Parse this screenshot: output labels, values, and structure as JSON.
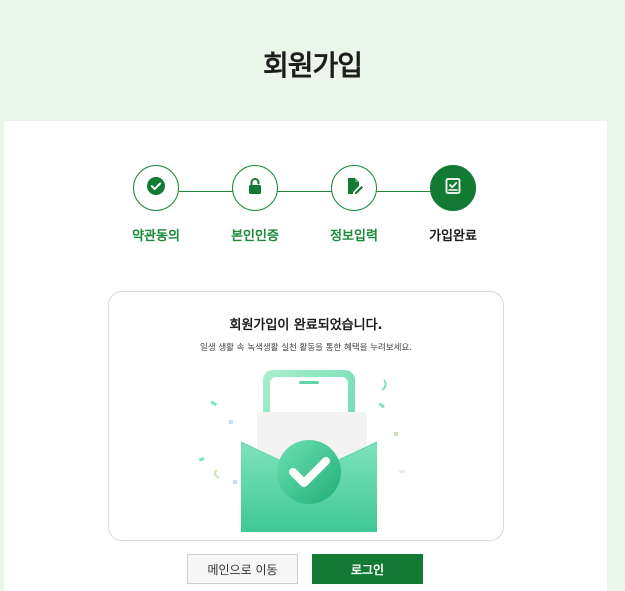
{
  "header": {
    "title": "회원가입"
  },
  "steps": [
    {
      "label": "약관동의",
      "icon": "check-circle-icon",
      "state": "done"
    },
    {
      "label": "본인인증",
      "icon": "lock-icon",
      "state": "done"
    },
    {
      "label": "정보입력",
      "icon": "edit-document-icon",
      "state": "done"
    },
    {
      "label": "가입완료",
      "icon": "check-document-icon",
      "state": "active"
    }
  ],
  "completion": {
    "title": "회원가입이 완료되었습니다.",
    "description": "일생 생활 속 녹색생활 실천 활동을 통한 혜택을 누려보세요.",
    "illustration": "phone-envelope-check-icon"
  },
  "buttons": {
    "main_label": "메인으로 이동",
    "login_label": "로그인"
  },
  "colors": {
    "brand_green": "#127a32",
    "step_green": "#1a8a3a",
    "background": "#eaf6ea",
    "mint": "#5ed6a8"
  }
}
